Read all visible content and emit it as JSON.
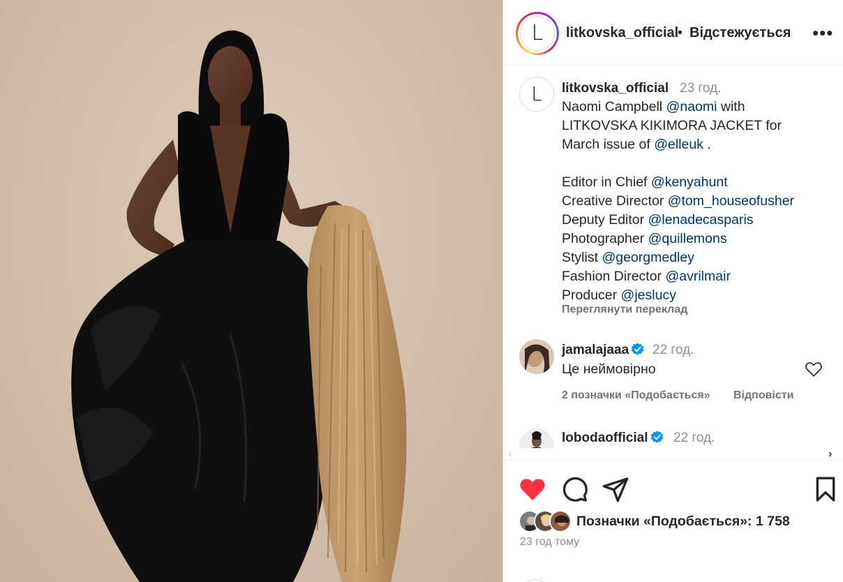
{
  "post": {
    "username": "litkovska_official",
    "separator": "•",
    "follow_status": "Відстежується",
    "avatar_letter": "L",
    "more_icon": "more-horizontal-icon"
  },
  "caption": {
    "username": "litkovska_official",
    "time": "23 год.",
    "lines": [
      [
        "Naomi Campbell ",
        "@naomi",
        " with"
      ],
      [
        "LITKOVSKA KIKIMORA JACKET for"
      ],
      [
        "March issue of ",
        "@elleuk",
        " ."
      ],
      [
        "Editor in Chief ",
        "@kenyahunt"
      ],
      [
        "Creative Director ",
        "@tom_houseofusher"
      ],
      [
        "Deputy Editor ",
        "@lenadecasparis"
      ],
      [
        "Photographer ",
        "@quillemons"
      ],
      [
        "Stylist ",
        "@georgmedley"
      ],
      [
        "Fashion Director ",
        "@avrilmair"
      ],
      [
        "Producer ",
        "@jeslucy"
      ]
    ],
    "see_translation": "Переглянути переклад"
  },
  "comments": [
    {
      "username": "jamalajaaa",
      "verified": true,
      "time": "22 год.",
      "text": "Це неймовірно",
      "likes": "2 позначки «Подобається»",
      "reply": "Відповісти"
    },
    {
      "username": "lobodaofficial",
      "verified": true,
      "time": "22 год."
    }
  ],
  "actions": {
    "like_icon": "heart-filled-icon",
    "comment_icon": "comment-icon",
    "share_icon": "send-icon",
    "save_icon": "bookmark-icon",
    "likes_text": "Позначки «Подобається»: 1 758",
    "time_ago": "23 год тому"
  },
  "colors": {
    "like_red": "#ff3040",
    "mention_blue": "#00376b",
    "verified_blue": "#0095f6",
    "muted_grey": "#737373"
  }
}
